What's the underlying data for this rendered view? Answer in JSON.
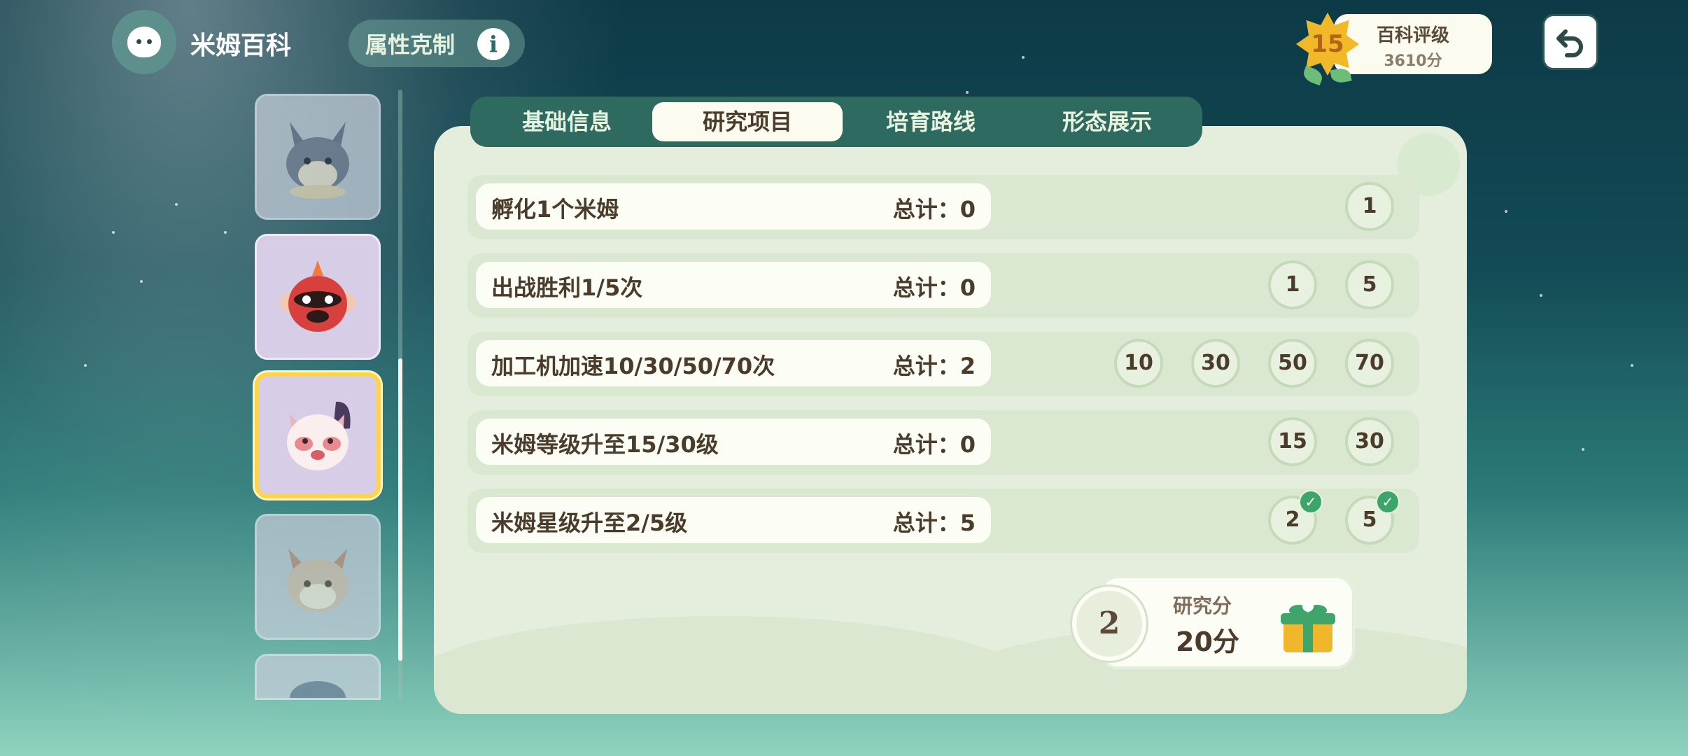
{
  "header": {
    "app_title": "米姆百科",
    "app_icon": "mim-blob-icon",
    "attr_button_label": "属性克制",
    "info_icon_text": "i",
    "rank": {
      "level": "15",
      "title": "百科评级",
      "score": "3610分"
    }
  },
  "tabs": [
    {
      "label": "基础信息",
      "active": false
    },
    {
      "label": "研究项目",
      "active": true
    },
    {
      "label": "培育路线",
      "active": false
    },
    {
      "label": "形态展示",
      "active": false
    }
  ],
  "research_items": [
    {
      "desc": "孵化1个米姆",
      "total": "总计：0",
      "milestones": [
        {
          "value": "1",
          "done": false
        }
      ]
    },
    {
      "desc": "出战胜利1/5次",
      "total": "总计：0",
      "milestones": [
        {
          "value": "1",
          "done": false
        },
        {
          "value": "5",
          "done": false
        }
      ]
    },
    {
      "desc": "加工机加速10/30/50/70次",
      "total": "总计：2",
      "milestones": [
        {
          "value": "10",
          "done": false
        },
        {
          "value": "30",
          "done": false
        },
        {
          "value": "50",
          "done": false
        },
        {
          "value": "70",
          "done": false
        }
      ]
    },
    {
      "desc": "米姆等级升至15/30级",
      "total": "总计：0",
      "milestones": [
        {
          "value": "15",
          "done": false
        },
        {
          "value": "30",
          "done": false
        }
      ]
    },
    {
      "desc": "米姆星级升至2/5级",
      "total": "总计：5",
      "milestones": [
        {
          "value": "2",
          "done": true
        },
        {
          "value": "5",
          "done": true
        }
      ]
    }
  ],
  "reward": {
    "count": "2",
    "label": "研究分",
    "value": "20分"
  },
  "monster_list": [
    {
      "name": "wolf-pup",
      "state": "dim"
    },
    {
      "name": "red-fire-ball",
      "state": "normal"
    },
    {
      "name": "pink-red-panda",
      "state": "selected"
    },
    {
      "name": "fox-cub",
      "state": "dim"
    },
    {
      "name": "blue-shell",
      "state": "dim"
    }
  ],
  "colors": {
    "panel": "#e5eedc",
    "tab_bar": "#2e6a60",
    "selected_border": "#ffd445",
    "check": "#3ea56a"
  }
}
